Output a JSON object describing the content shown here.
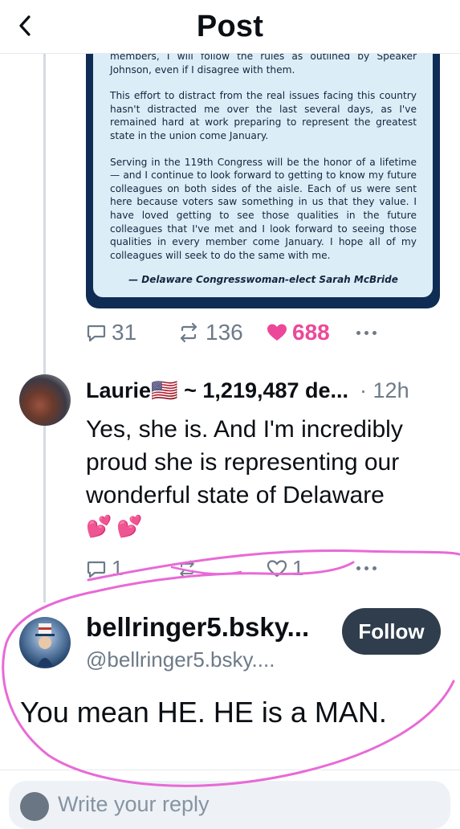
{
  "header": {
    "title": "Post",
    "back_icon": "chevron-left-icon"
  },
  "quoted_statement": {
    "paragraphs": [
      "members, I will follow the rules as outlined by Speaker Johnson, even if I disagree with them.",
      "This effort to distract from the real issues facing this country hasn't distracted me over the last several days, as I've remained hard at work preparing to represent the greatest state in the union come January.",
      "Serving in the 119th Congress will be the honor of a lifetime — and I continue to look forward to getting to know my future colleagues on both sides of the aisle. Each of us were sent here because voters saw something in us that they value. I have loved getting to see those qualities in the future colleagues that I've met and I look forward to seeing those qualities in every member come January. I hope all of my colleagues will seek to do the same with me."
    ],
    "signature": "— Delaware Congresswoman-elect Sarah McBride"
  },
  "root_actions": {
    "replies": "31",
    "reposts": "136",
    "likes": "688",
    "like_color": "#ec4899"
  },
  "reply_post": {
    "author": "Laurie🇺🇸 ~ 1,219,487 de...",
    "time": "· 12h",
    "text": "Yes, she is.  And I'm incredibly proud she is representing our wonderful state of Delaware",
    "emoji": "💕💕",
    "actions": {
      "replies": "1",
      "reposts": "",
      "likes": "1"
    }
  },
  "focused_post": {
    "display_name": "bellringer5.bsky...",
    "handle": "@bellringer5.bsky....",
    "follow_label": "Follow",
    "text": "You mean HE. HE is a MAN."
  },
  "composer": {
    "placeholder": "Write your reply"
  },
  "colors": {
    "accent_pink": "#ec4899",
    "muted": "#6d7a88",
    "follow_bg": "#2f3d4d",
    "card_navy": "#0f2c55",
    "card_bg": "#dbeef8"
  }
}
